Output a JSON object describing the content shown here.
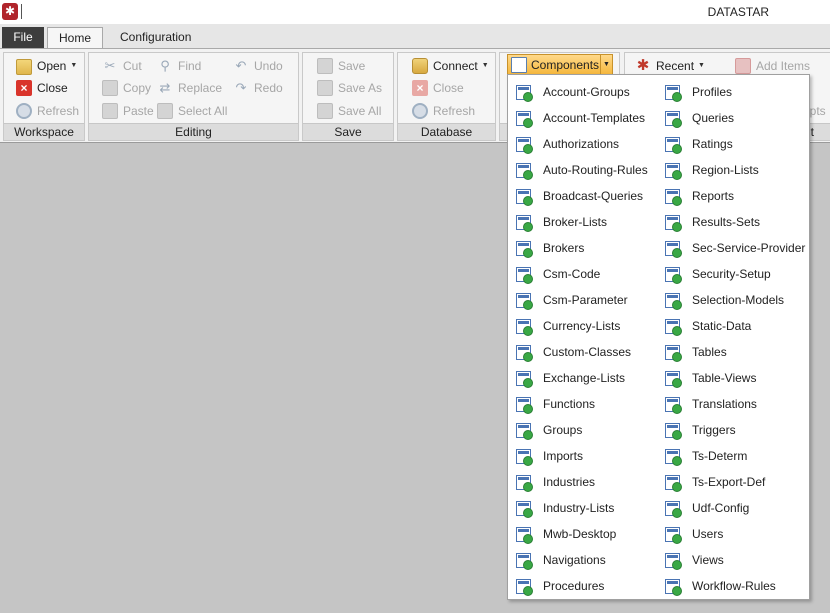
{
  "window": {
    "title": "DATASTAR",
    "app_icon": "✱"
  },
  "tabs": {
    "file": "File",
    "home": "Home",
    "configuration": "Configuration"
  },
  "ribbon": {
    "workspace": {
      "label": "Workspace",
      "open": "Open",
      "close": "Close",
      "refresh": "Refresh"
    },
    "editing": {
      "label": "Editing",
      "cut": "Cut",
      "copy": "Copy",
      "paste": "Paste",
      "find": "Find",
      "replace": "Replace",
      "select_all": "Select All",
      "undo": "Undo",
      "redo": "Redo"
    },
    "save": {
      "label": "Save",
      "save": "Save",
      "save_as": "Save As",
      "save_all": "Save All"
    },
    "database": {
      "label": "Database",
      "connect": "Connect",
      "close": "Close",
      "refresh": "Refresh"
    },
    "components_button": "Components",
    "recent": "Recent",
    "add_items": "Add Items",
    "partial_scripts": "ipts",
    "partial_group_label": "t"
  },
  "components_menu": {
    "left": [
      "Account-Groups",
      "Account-Templates",
      "Authorizations",
      "Auto-Routing-Rules",
      "Broadcast-Queries",
      "Broker-Lists",
      "Brokers",
      "Csm-Code",
      "Csm-Parameter",
      "Currency-Lists",
      "Custom-Classes",
      "Exchange-Lists",
      "Functions",
      "Groups",
      "Imports",
      "Industries",
      "Industry-Lists",
      "Mwb-Desktop",
      "Navigations",
      "Procedures"
    ],
    "right": [
      "Profiles",
      "Queries",
      "Ratings",
      "Region-Lists",
      "Reports",
      "Results-Sets",
      "Sec-Service-Provider",
      "Security-Setup",
      "Selection-Models",
      "Static-Data",
      "Tables",
      "Table-Views",
      "Translations",
      "Triggers",
      "Ts-Determ",
      "Ts-Export-Def",
      "Udf-Config",
      "Users",
      "Views",
      "Workflow-Rules"
    ]
  },
  "colors": {
    "accent": "#f5b63a",
    "file_tab": "#3d3d3d",
    "background": "#c5c5c5"
  }
}
